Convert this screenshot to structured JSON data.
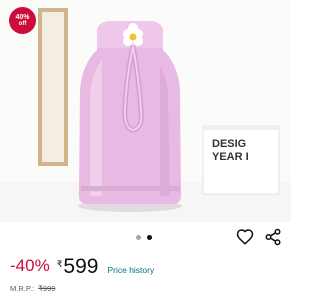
{
  "product": {
    "badge_percent": "40%",
    "badge_off": "off",
    "box_text_line1": "DESIG",
    "box_text_line2": "YEAR I"
  },
  "carousel": {
    "total": 2,
    "active_index": 1
  },
  "actions": {
    "wishlist_icon": "heart-outline-icon",
    "share_icon": "share-icon"
  },
  "pricing": {
    "discount": "-40%",
    "currency_symbol": "₹",
    "price": "599",
    "price_history_label": "Price history",
    "mrp_label": "M.R.P.:",
    "mrp_value": "₹999"
  },
  "colors": {
    "discount_red": "#cc0c39",
    "link_teal": "#007185",
    "bottle_pink": "#e8b9e3"
  }
}
